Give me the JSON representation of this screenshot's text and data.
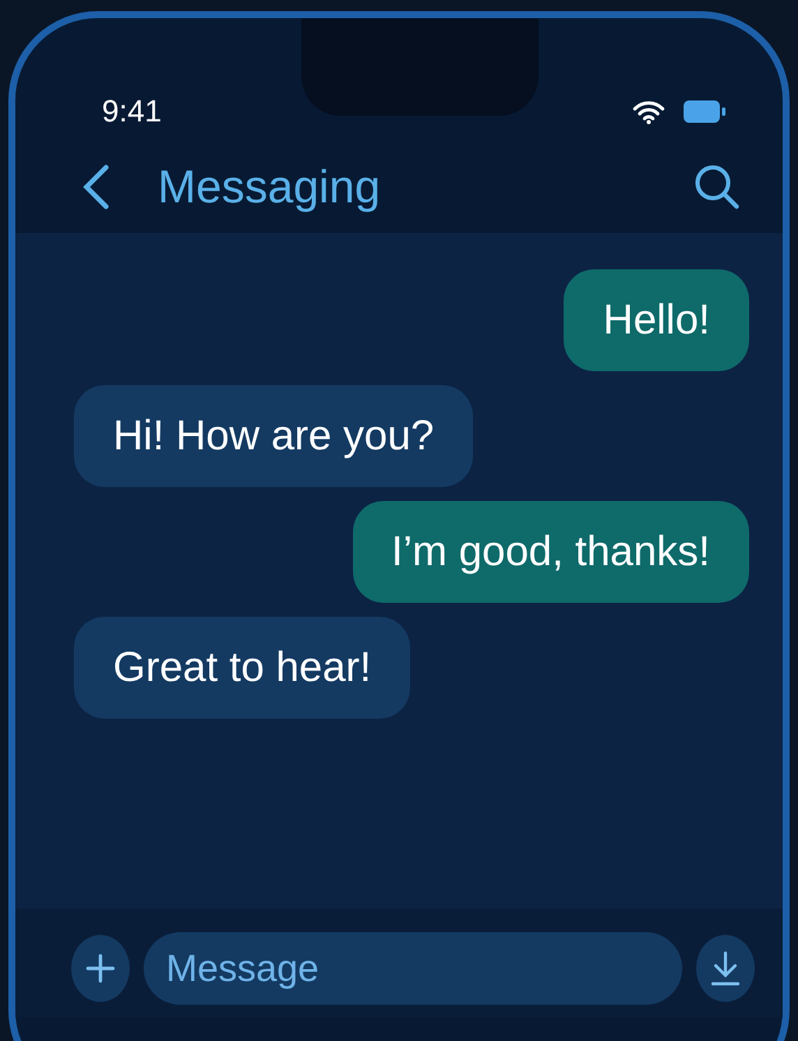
{
  "status_bar": {
    "time": "9:41"
  },
  "header": {
    "title": "Messaging"
  },
  "messages": [
    {
      "text": "Hello!",
      "kind": "sent"
    },
    {
      "text": "Hi! How are you?",
      "kind": "received"
    },
    {
      "text": "I’m good, thanks!",
      "kind": "sent"
    },
    {
      "text": "Great to hear!",
      "kind": "received"
    }
  ],
  "composer": {
    "placeholder": "Message"
  }
}
